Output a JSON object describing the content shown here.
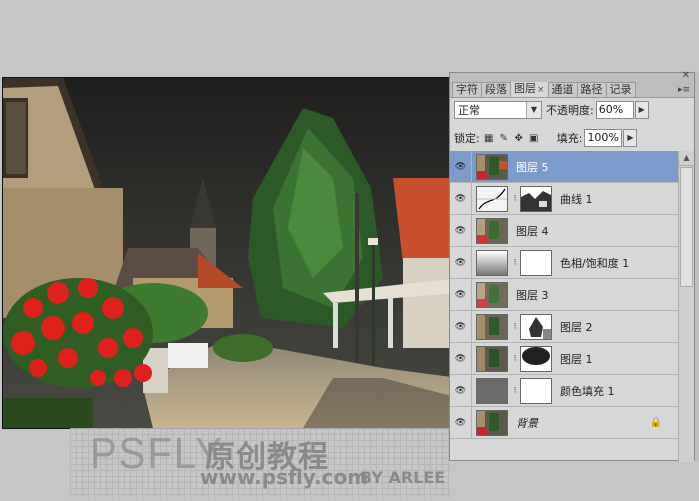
{
  "panel": {
    "tabs": [
      {
        "label": "字符",
        "active": false
      },
      {
        "label": "段落",
        "active": false
      },
      {
        "label": "图层",
        "active": true
      },
      {
        "label": "通道",
        "active": false
      },
      {
        "label": "路径",
        "active": false
      },
      {
        "label": "记录",
        "active": false
      }
    ],
    "close_glyph": "✕",
    "blend_mode": "正常",
    "opacity_label": "不透明度:",
    "opacity_value": "60%",
    "lock_label": "锁定:",
    "fill_label": "填充:",
    "fill_value": "100%"
  },
  "layers": [
    {
      "name": "图层 5",
      "selected": true,
      "thumb": "photo",
      "mask": null
    },
    {
      "name": "曲线 1",
      "selected": false,
      "thumb": "curves",
      "mask": "curves-mask"
    },
    {
      "name": "图层 4",
      "selected": false,
      "thumb": "photo",
      "mask": null
    },
    {
      "name": "色相/饱和度 1",
      "selected": false,
      "thumb": "hue",
      "mask": "white"
    },
    {
      "name": "图层 3",
      "selected": false,
      "thumb": "photo",
      "mask": null
    },
    {
      "name": "图层 2",
      "selected": false,
      "thumb": "photo",
      "mask": "tree-mask"
    },
    {
      "name": "图层 1",
      "selected": false,
      "thumb": "photo",
      "mask": "dark-mask"
    },
    {
      "name": "颜色填充 1",
      "selected": false,
      "thumb": "gray",
      "mask": "white"
    },
    {
      "name": "背景",
      "selected": false,
      "thumb": "photo",
      "mask": null,
      "locked": true
    }
  ],
  "watermark": {
    "brand": "PSFLY",
    "title": "原创教程",
    "url": "www.psfly.com",
    "author": "BY ARLEE"
  },
  "colors": {
    "selection": "#7b9bcb",
    "panel_bg": "#d7d7d7",
    "flower_red": "#e0201a",
    "roof_orange": "#d2522c"
  }
}
